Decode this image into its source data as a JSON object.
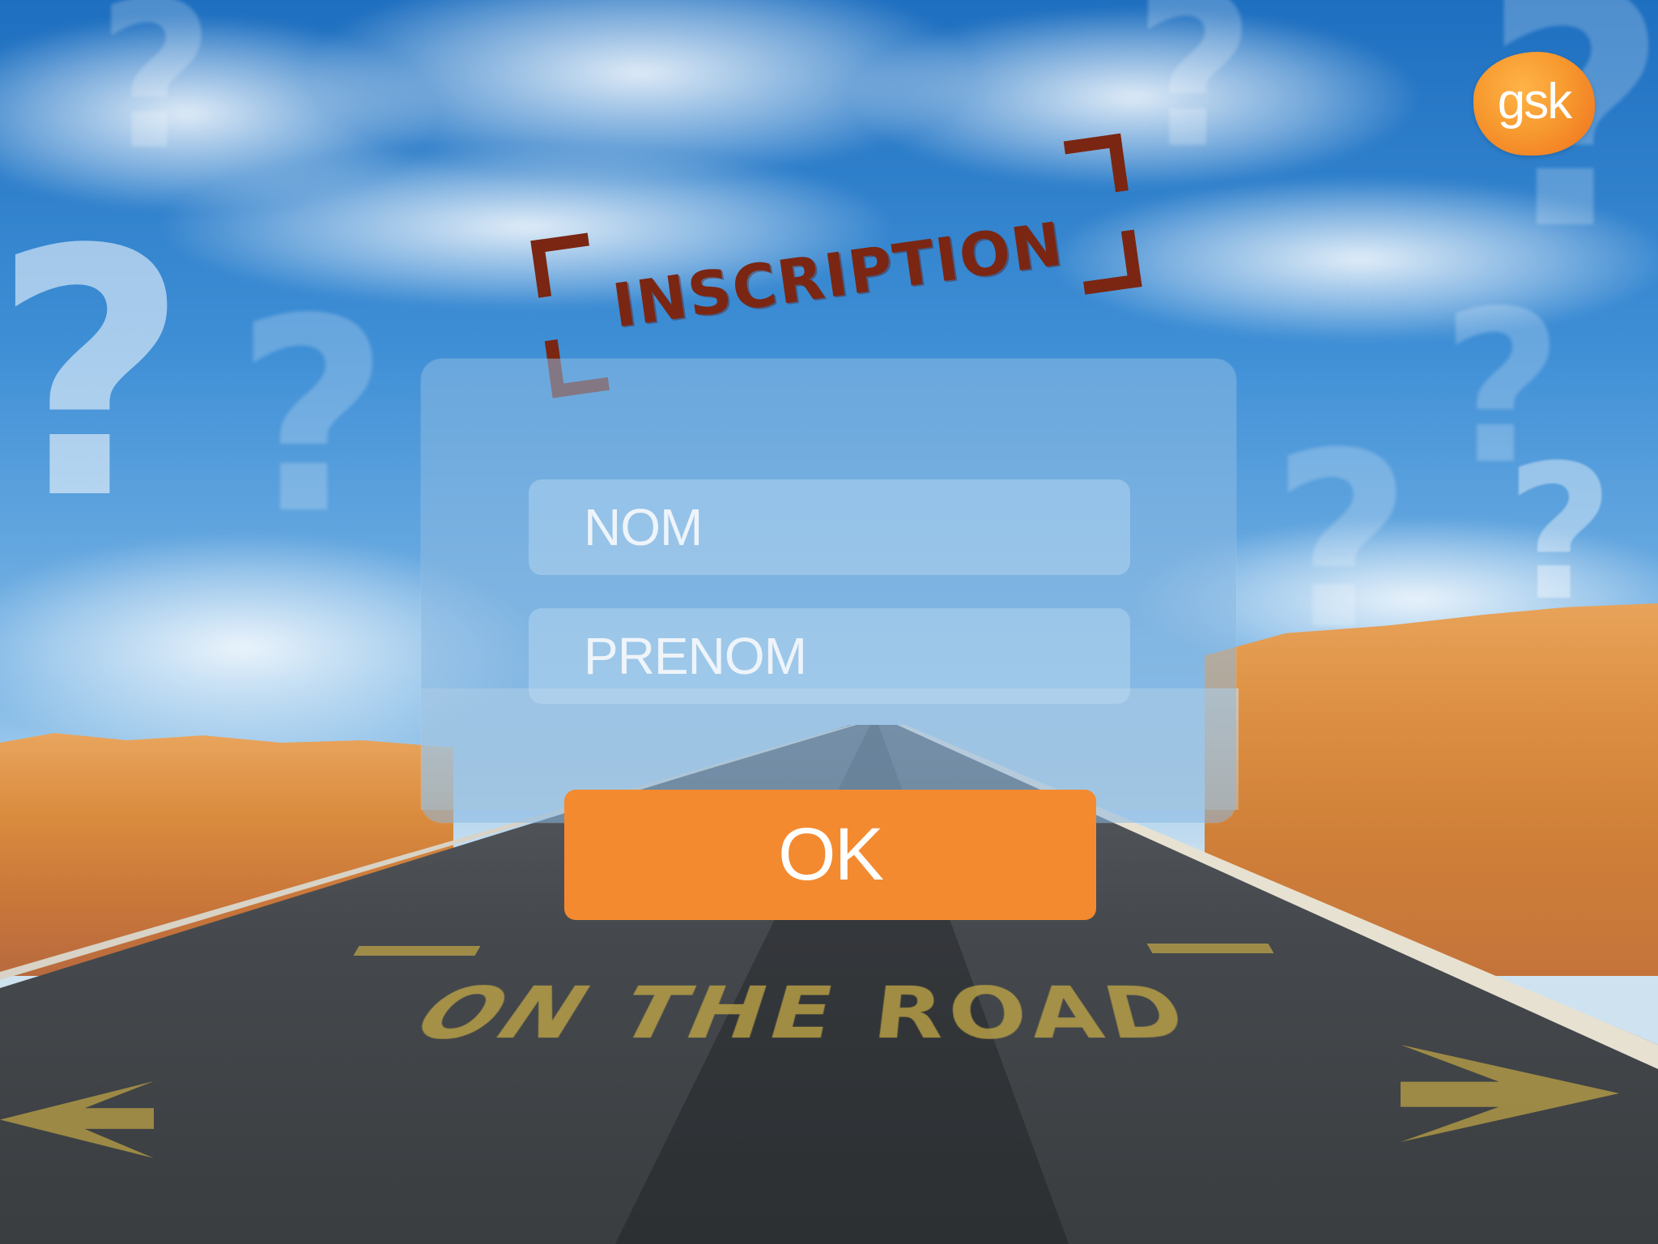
{
  "logo": {
    "text": "gsk",
    "color": "#f38a30"
  },
  "title": {
    "text": "INSCRIPTION",
    "color": "#7a2612"
  },
  "form": {
    "nom_placeholder": "NOM",
    "prenom_placeholder": "PRENOM",
    "submit_label": "OK",
    "submit_color": "#f38a30"
  },
  "background": {
    "road_text": "ON THE ROAD",
    "decoration_glyph": "?"
  }
}
